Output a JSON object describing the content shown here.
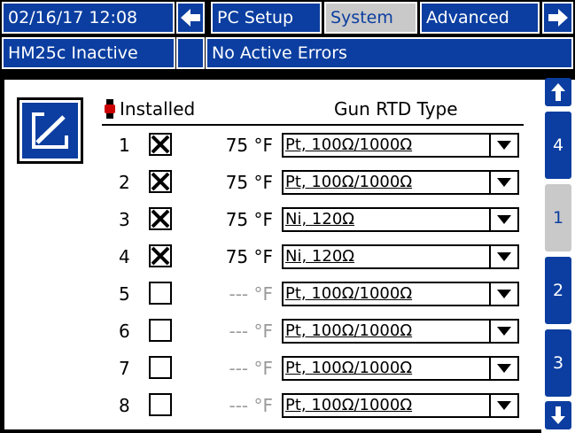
{
  "header": {
    "datetime": "02/16/17 12:08",
    "tabs": [
      {
        "label": "PC Setup"
      },
      {
        "label": "System"
      },
      {
        "label": "Advanced"
      }
    ],
    "selected_tab": "System",
    "status": "HM25c Inactive",
    "errors": "No Active Errors"
  },
  "table": {
    "installed_label": "Installed",
    "gun_rtd_label": "Gun RTD Type",
    "unit": "°F",
    "rows": [
      {
        "num": "1",
        "installed": true,
        "temp": "75 °F",
        "rtd_type": "Pt, 100Ω/1000Ω"
      },
      {
        "num": "2",
        "installed": true,
        "temp": "75 °F",
        "rtd_type": "Pt, 100Ω/1000Ω"
      },
      {
        "num": "3",
        "installed": true,
        "temp": "75 °F",
        "rtd_type": "Ni, 120Ω"
      },
      {
        "num": "4",
        "installed": true,
        "temp": "75 °F",
        "rtd_type": "Ni, 120Ω"
      },
      {
        "num": "5",
        "installed": false,
        "temp": "--- °F",
        "rtd_type": "Pt, 100Ω/1000Ω"
      },
      {
        "num": "6",
        "installed": false,
        "temp": "--- °F",
        "rtd_type": "Pt, 100Ω/1000Ω"
      },
      {
        "num": "7",
        "installed": false,
        "temp": "--- °F",
        "rtd_type": "Pt, 100Ω/1000Ω"
      },
      {
        "num": "8",
        "installed": false,
        "temp": "--- °F",
        "rtd_type": "Pt, 100Ω/1000Ω"
      }
    ]
  },
  "pager": {
    "pages": [
      "4",
      "1",
      "2",
      "3"
    ],
    "selected": "1"
  },
  "colors": {
    "accent": "#0b3ea0",
    "selected": "#c9c9c9",
    "disabled_text": "#9a9a9a"
  },
  "icons": {
    "edit": "edit-icon",
    "left": "arrow-left-icon",
    "right": "arrow-right-icon",
    "up": "arrow-up-icon",
    "down": "arrow-down-icon",
    "gun": "gun-icon",
    "checked": "check-x-icon",
    "dropdown": "dropdown-arrow-icon"
  }
}
